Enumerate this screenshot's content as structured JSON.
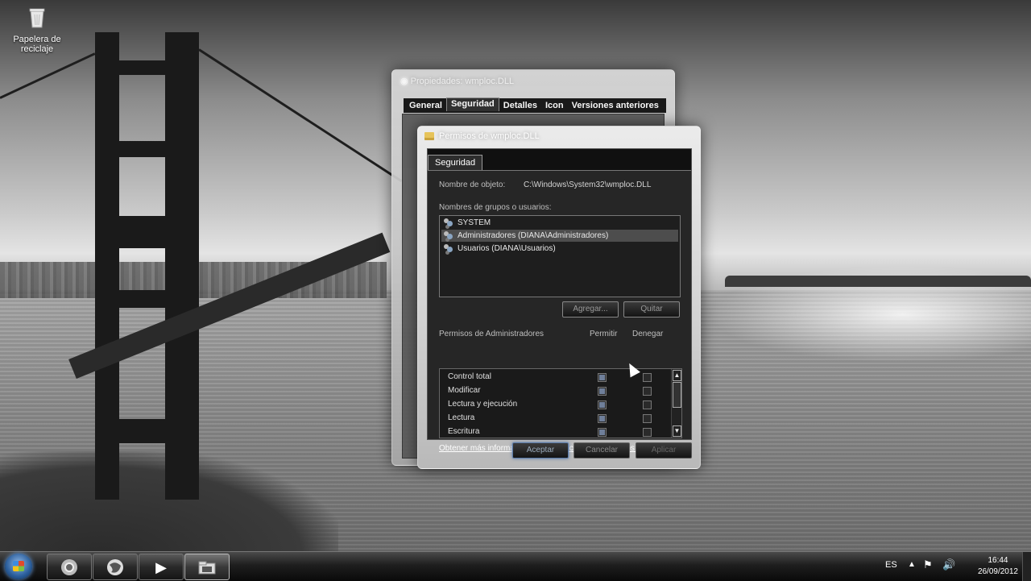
{
  "desktop": {
    "recycle_bin_label": "Papelera de reciclaje"
  },
  "back_window": {
    "title": "Propiedades: wmploc.DLL",
    "tabs": [
      "General",
      "Seguridad",
      "Detalles",
      "Icon",
      "Versiones anteriores"
    ],
    "active_tab": "Seguridad"
  },
  "dialog": {
    "title": "Permisos de wmploc.DLL",
    "tab": "Seguridad",
    "object_label": "Nombre de objeto:",
    "object_value": "C:\\Windows\\System32\\wmploc.DLL",
    "groups_label": "Nombres de grupos o usuarios:",
    "users": [
      {
        "name": "SYSTEM",
        "selected": false
      },
      {
        "name": "Administradores (DIANA\\Administradores)",
        "selected": true
      },
      {
        "name": "Usuarios (DIANA\\Usuarios)",
        "selected": false
      }
    ],
    "add_button": "Agregar...",
    "remove_button": "Quitar",
    "perms_label": "Permisos de Administradores",
    "allow_header": "Permitir",
    "deny_header": "Denegar",
    "permissions": [
      {
        "name": "Control total",
        "allow": true,
        "deny": false
      },
      {
        "name": "Modificar",
        "allow": true,
        "deny": false
      },
      {
        "name": "Lectura y ejecución",
        "allow": true,
        "deny": false
      },
      {
        "name": "Lectura",
        "allow": true,
        "deny": false
      },
      {
        "name": "Escritura",
        "allow": true,
        "deny": false
      }
    ],
    "info_link": "Obtener más información acerca de control y permisos de acceso",
    "ok_button": "Aceptar",
    "cancel_button": "Cancelar",
    "apply_button": "Aplicar"
  },
  "taskbar": {
    "apps": [
      "chrome-icon",
      "firefox-icon",
      "media-player-icon",
      "explorer-icon"
    ],
    "language": "ES",
    "time": "16:44",
    "date": "26/09/2012"
  }
}
